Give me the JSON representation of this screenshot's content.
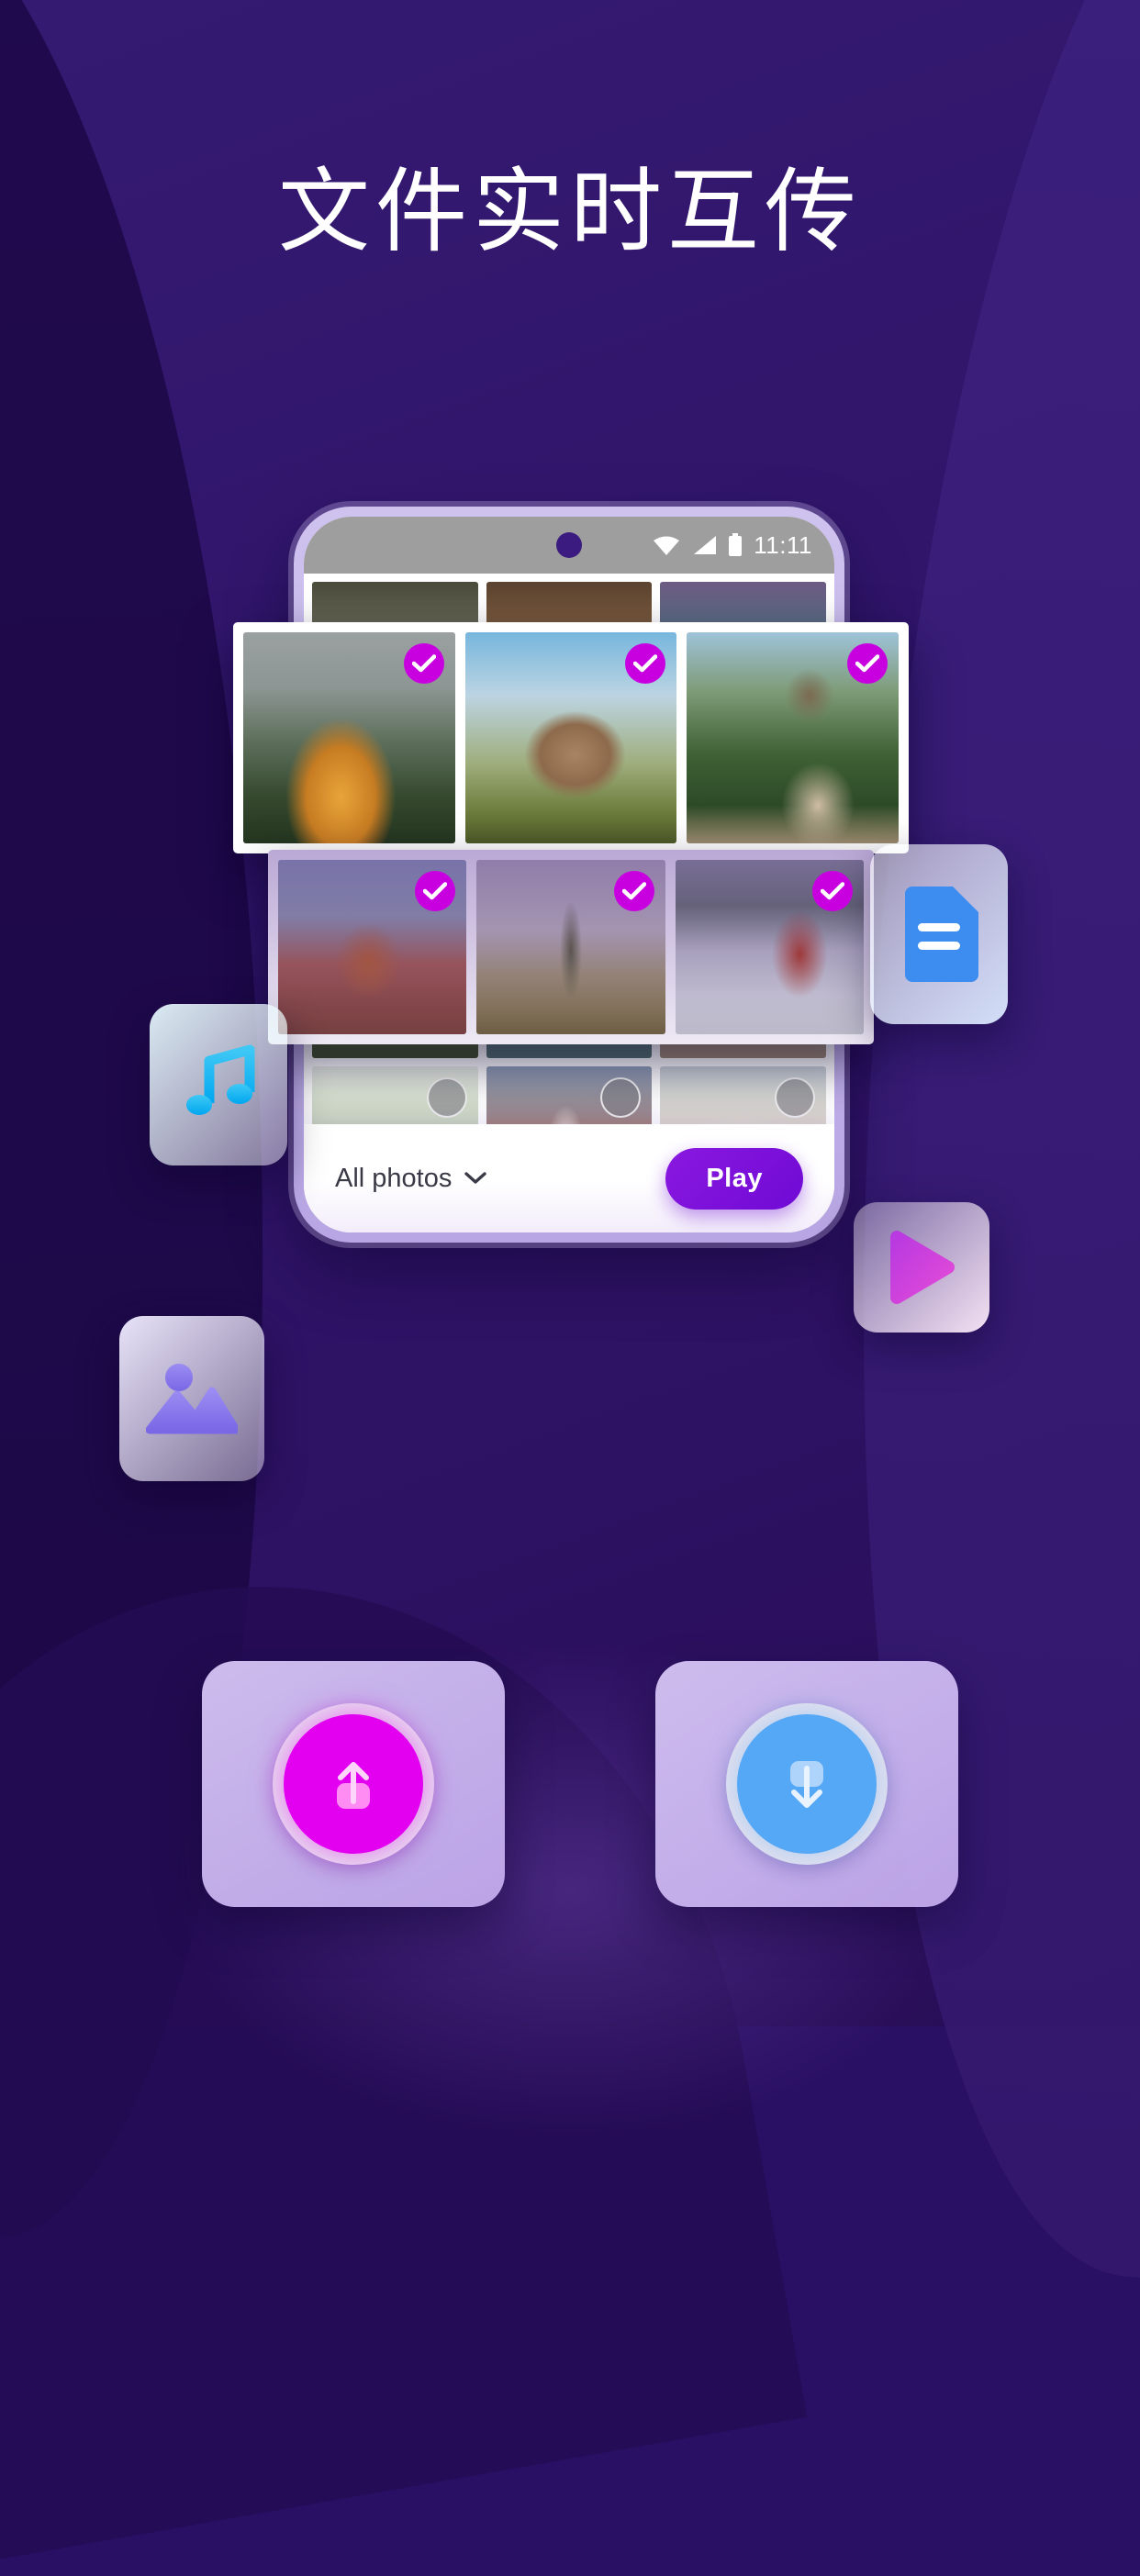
{
  "headline": "文件实时互传",
  "colors": {
    "background_top": "#351a72",
    "background_bottom": "#280d57",
    "accent_magenta": "#c800e0",
    "accent_purple": "#6f0ad4",
    "accent_blue": "#55a8f5",
    "send_circle": "#e300f0",
    "receive_circle": "#55a8f5"
  },
  "phone": {
    "status_bar": {
      "time": "11:11",
      "icons": [
        "wifi-icon",
        "signal-icon",
        "battery-icon"
      ],
      "camera": "front-camera-dot"
    },
    "bottom_bar": {
      "filter_label": "All photos",
      "filter_chevron": "chevron-down-icon",
      "play_label": "Play"
    }
  },
  "panels": {
    "panel_top": {
      "selected": true,
      "photos": [
        {
          "name": "woman-looking-at-misty-mountains",
          "style": "p-mountainwoman",
          "checked": true
        },
        {
          "name": "rock-formation-with-clouds",
          "style": "p-rockcactus",
          "checked": true
        },
        {
          "name": "couple-sitting-on-cliff",
          "style": "p-cliffcouple",
          "checked": true
        }
      ]
    },
    "panel_middle": {
      "selected": true,
      "photos": [
        {
          "name": "woman-on-city-bike-lane",
          "style": "p-citybike",
          "checked": true
        },
        {
          "name": "saguaro-cactus-desert",
          "style": "p-cactus",
          "checked": true
        },
        {
          "name": "woman-photographing-lake",
          "style": "p-lakephoto",
          "checked": true
        }
      ]
    }
  },
  "photo_grid": {
    "rows": [
      [
        {
          "name": "laughing-woman-on-road",
          "style": "p-roadlaugh",
          "checked": false,
          "badge": false
        },
        {
          "name": "green-van-in-forest",
          "style": "p-vanforest",
          "checked": false,
          "badge": false
        },
        {
          "name": "mountain-lake-reflection",
          "style": "p-lakemirror",
          "checked": false,
          "badge": false
        }
      ],
      [
        {
          "name": "venice-gondolas-at-dusk",
          "style": "p-venice",
          "checked": false,
          "badge": true
        },
        {
          "name": "campervan-on-coastal-cliff",
          "style": "p-campervan",
          "checked": false,
          "badge": true
        },
        {
          "name": "two-women-playing-guitar",
          "style": "p-guitar",
          "checked": false,
          "badge": true
        }
      ],
      [
        {
          "name": "neuschwanstein-castle",
          "style": "p-castle",
          "checked": false,
          "badge": true
        },
        {
          "name": "surfers-in-the-ocean",
          "style": "p-surfers",
          "checked": false,
          "badge": true
        },
        {
          "name": "couple-walking-on-beach",
          "style": "p-beachcouple",
          "checked": false,
          "badge": true
        }
      ],
      [
        {
          "name": "man-with-dog-in-field",
          "style": "p-dogman",
          "checked": false,
          "badge": true
        },
        {
          "name": "church-tower-at-sunset",
          "style": "p-church",
          "checked": false,
          "badge": true
        },
        {
          "name": "historic-palace-building",
          "style": "p-palace",
          "checked": false,
          "badge": true
        }
      ]
    ]
  },
  "file_cards": [
    {
      "id": "document",
      "icon": "document-icon",
      "color": "#3d8cf0"
    },
    {
      "id": "music",
      "icon": "music-note-icon",
      "color": "#18b7f0"
    },
    {
      "id": "video",
      "icon": "play-triangle-icon",
      "color": "#d42ad8"
    },
    {
      "id": "image",
      "icon": "image-picture-icon",
      "color": "#7c6ae8"
    }
  ],
  "actions": [
    {
      "id": "send",
      "icon": "upload-arrow-icon",
      "color": "#e300f0"
    },
    {
      "id": "receive",
      "icon": "download-arrow-icon",
      "color": "#55a8f5"
    }
  ]
}
